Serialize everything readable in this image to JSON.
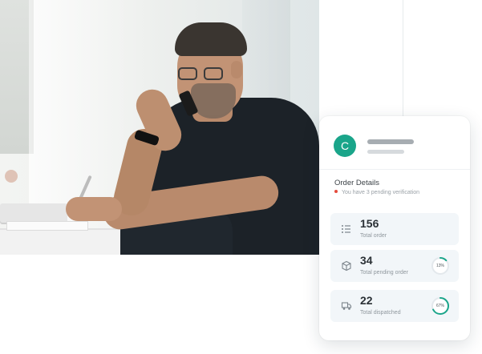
{
  "card": {
    "avatar_letter": "C",
    "title": "Order Details",
    "pending_note": "You have 3 pending verification",
    "stats": [
      {
        "value": "156",
        "label": "Total order",
        "icon": "list-icon"
      },
      {
        "value": "34",
        "label": "Total pending order",
        "icon": "box-icon",
        "progress_label": "13%",
        "progress": 0.13
      },
      {
        "value": "22",
        "label": "Total dispatched",
        "icon": "truck-icon",
        "progress_label": "67%",
        "progress": 0.67
      }
    ]
  },
  "colors": {
    "accent": "#1aa58a",
    "alert": "#e54b3c",
    "ring_track": "#e3e8ec"
  }
}
